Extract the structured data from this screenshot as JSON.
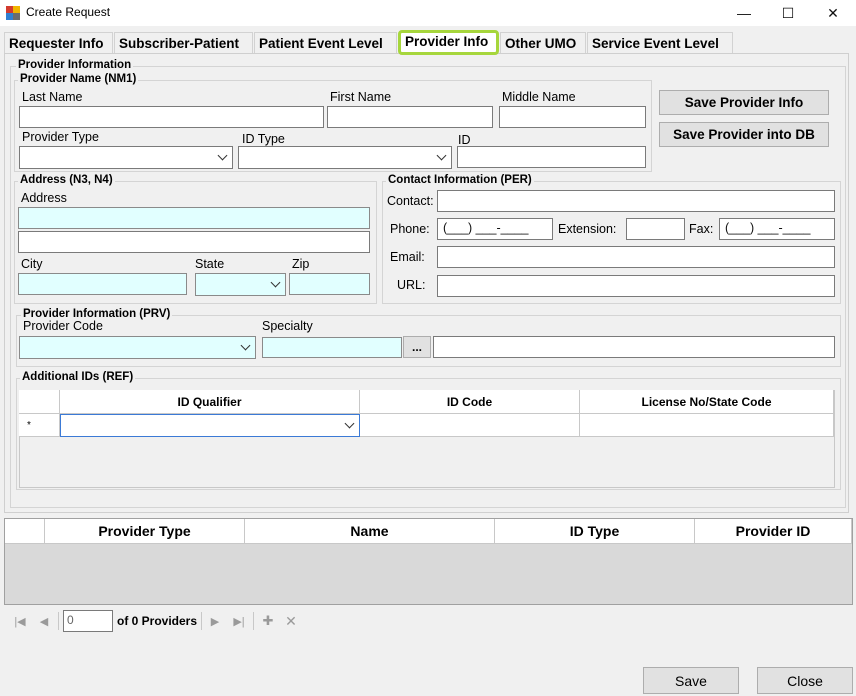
{
  "window": {
    "title": "Create Request",
    "minimize_glyph": "—",
    "maximize_glyph": "☐",
    "close_glyph": "✕"
  },
  "tabs": [
    {
      "label": "Requester Info"
    },
    {
      "label": "Subscriber-Patient"
    },
    {
      "label": "Patient Event Level"
    },
    {
      "label": "Provider Info"
    },
    {
      "label": "Other UMO"
    },
    {
      "label": "Service Event Level"
    }
  ],
  "provider_info": {
    "group_title": "Provider Information",
    "name_group": {
      "title": "Provider Name (NM1)",
      "last_name_label": "Last Name",
      "first_name_label": "First Name",
      "middle_name_label": "Middle Name",
      "provider_type_label": "Provider Type",
      "id_type_label": "ID Type",
      "id_label": "ID"
    },
    "save_provider_info": "Save Provider Info",
    "save_provider_db": "Save Provider into DB",
    "address_group": {
      "title": "Address (N3, N4)",
      "address_label": "Address",
      "city_label": "City",
      "state_label": "State",
      "zip_label": "Zip"
    },
    "contact_group": {
      "title": "Contact Information (PER)",
      "contact_label": "Contact:",
      "phone_label": "Phone:",
      "phone_mask": "(___) ___-____",
      "extension_label": "Extension:",
      "fax_label": "Fax:",
      "fax_mask": "(___) ___-____",
      "email_label": "Email:",
      "url_label": "URL:"
    },
    "prv_group": {
      "title": "Provider Information (PRV)",
      "provider_code_label": "Provider Code",
      "specialty_label": "Specialty",
      "browse_label": "..."
    },
    "ref_group": {
      "title": "Additional IDs (REF)",
      "columns": [
        "ID Qualifier",
        "ID Code",
        "License No/State Code"
      ],
      "new_row_marker": "*"
    }
  },
  "providers_grid": {
    "columns": [
      "Provider Type",
      "Name",
      "ID Type",
      "Provider ID"
    ]
  },
  "navigator": {
    "position": "0",
    "count_label": "of 0 Providers",
    "first_glyph": "|◀",
    "prev_glyph": "◀",
    "next_glyph": "▶",
    "last_glyph": "▶|",
    "add_glyph": "✚",
    "delete_glyph": "✕"
  },
  "footer": {
    "save_label": "Save",
    "close_label": "Close"
  }
}
